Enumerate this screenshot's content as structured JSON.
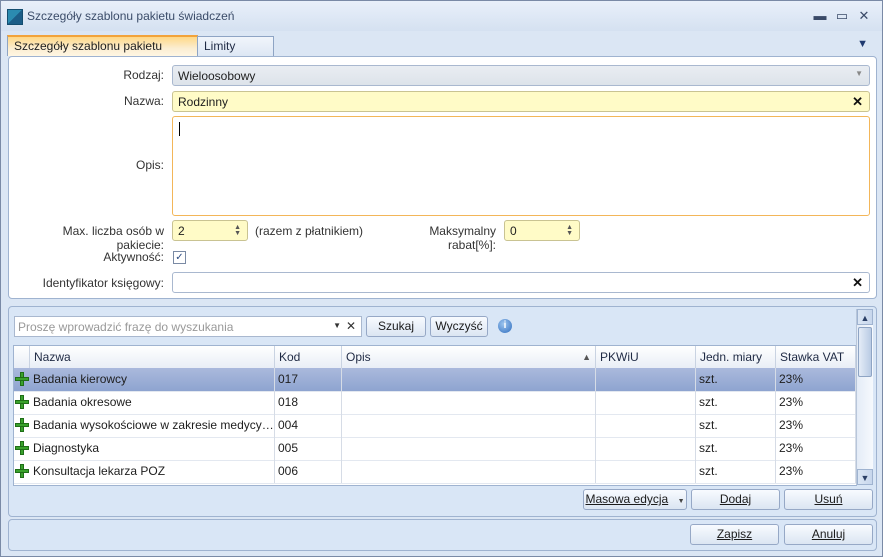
{
  "window": {
    "title": "Szczegóły szablonu pakietu świadczeń",
    "minimize": "▬",
    "maximize": "▭",
    "close": "✕"
  },
  "tabs": [
    {
      "label": "Szczegóły szablonu pakietu [Alt+1]"
    },
    {
      "label": "Limity [Alt+2]"
    }
  ],
  "form": {
    "rodzaj_label": "Rodzaj:",
    "rodzaj_value": "Wieloosobowy",
    "nazwa_label": "Nazwa:",
    "nazwa_value": "Rodzinny",
    "opis_label": "Opis:",
    "opis_value": "",
    "max_osob_label": "Max. liczba osób w pakiecie:",
    "max_osob_value": "2",
    "max_osob_note": "(razem z płatnikiem)",
    "rabat_label": "Maksymalny rabat[%]:",
    "rabat_value": "0",
    "aktywnosc_label": "Aktywność:",
    "aktywnosc_checked": true,
    "identyfikator_label": "Identyfikator księgowy:",
    "identyfikator_value": ""
  },
  "search": {
    "placeholder": "Proszę wprowadzić frazę do wyszukania",
    "search_button": "Szukaj",
    "clear_button": "Wyczyść"
  },
  "table": {
    "columns": [
      "Nazwa",
      "Kod",
      "Opis",
      "PKWiU",
      "Jedn. miary",
      "Stawka VAT"
    ],
    "rows": [
      {
        "nazwa": "Badania kierowcy",
        "kod": "017",
        "opis": "",
        "pkwiu": "",
        "jm": "szt.",
        "vat": "23%"
      },
      {
        "nazwa": "Badania okresowe",
        "kod": "018",
        "opis": "",
        "pkwiu": "",
        "jm": "szt.",
        "vat": "23%"
      },
      {
        "nazwa": "Badania wysokościowe w zakresie medycyny pr...",
        "kod": "004",
        "opis": "",
        "pkwiu": "",
        "jm": "szt.",
        "vat": "23%"
      },
      {
        "nazwa": "Diagnostyka",
        "kod": "005",
        "opis": "",
        "pkwiu": "",
        "jm": "szt.",
        "vat": "23%"
      },
      {
        "nazwa": "Konsultacja lekarza POZ",
        "kod": "006",
        "opis": "",
        "pkwiu": "",
        "jm": "szt.",
        "vat": "23%"
      }
    ]
  },
  "grid_buttons": {
    "masowa_edycja": "Masowa edycja",
    "dodaj": "Dodaj",
    "usun": "Usuń"
  },
  "footer": {
    "zapisz": "Zapisz",
    "anuluj": "Anuluj"
  }
}
